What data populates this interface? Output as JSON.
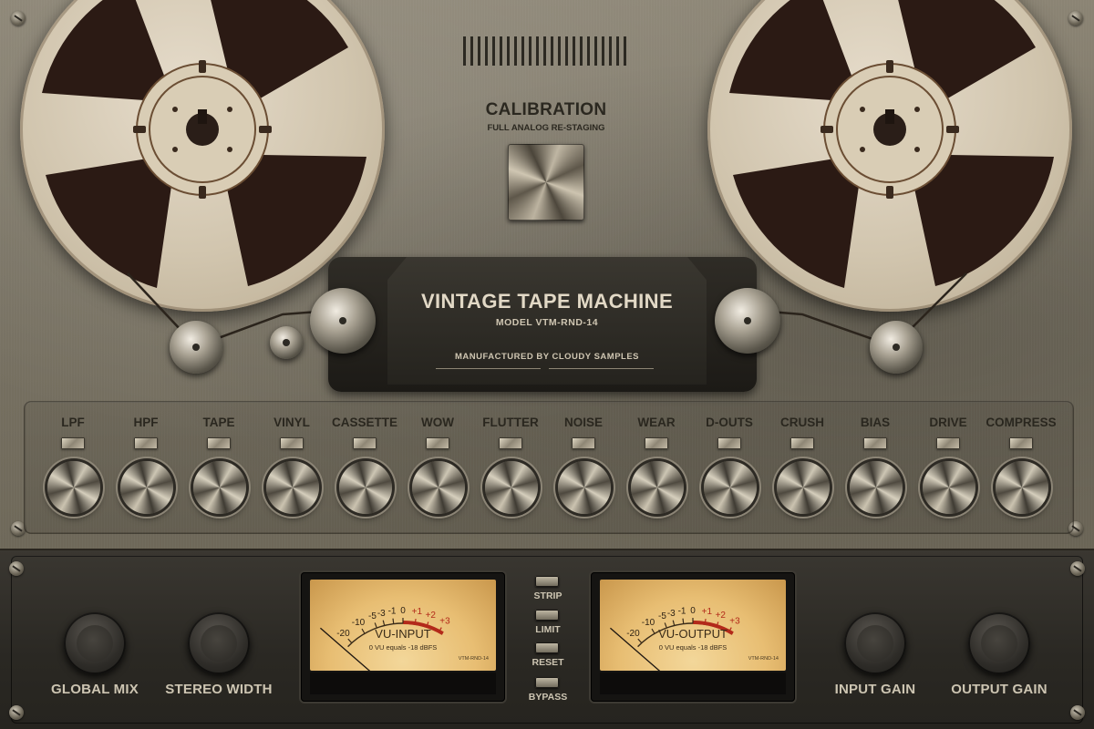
{
  "calibration": {
    "title": "CALIBRATION",
    "subtitle": "FULL ANALOG RE-STAGING"
  },
  "nameplate": {
    "title": "VINTAGE TAPE MACHINE",
    "model": "MODEL VTM-RND-14",
    "manufacturer": "MANUFACTURED BY CLOUDY SAMPLES"
  },
  "effects": [
    "LPF",
    "HPF",
    "TAPE",
    "VINYL",
    "CASSETTE",
    "WOW",
    "FLUTTER",
    "NOISE",
    "WEAR",
    "D-OUTS",
    "CRUSH",
    "BIAS",
    "DRIVE",
    "COMPRESS"
  ],
  "knobs": {
    "global_mix": "GLOBAL MIX",
    "stereo_width": "STEREO WIDTH",
    "input_gain": "INPUT GAIN",
    "output_gain": "OUTPUT GAIN"
  },
  "vu_scale": [
    "-20",
    "-10",
    "-5",
    "-3",
    "-1",
    "0",
    "+1",
    "+2",
    "+3"
  ],
  "vu_input": {
    "title": "VU-INPUT",
    "calibration": "0 VU equals -18 dBFS",
    "model": "VTM-RND-14"
  },
  "vu_output": {
    "title": "VU-OUTPUT",
    "calibration": "0 VU equals -18 dBFS",
    "model": "VTM-RND-14"
  },
  "switches": {
    "strip": "STRIP",
    "limit": "LIMIT",
    "reset": "RESET",
    "bypass": "BYPASS"
  },
  "colors": {
    "panel": "#7a7465",
    "rack": "#2a2823",
    "meter_face": "#e8be73",
    "label_dark": "#2a271f",
    "label_light": "#cdc5b2",
    "red_zone": "#b32a1a"
  }
}
